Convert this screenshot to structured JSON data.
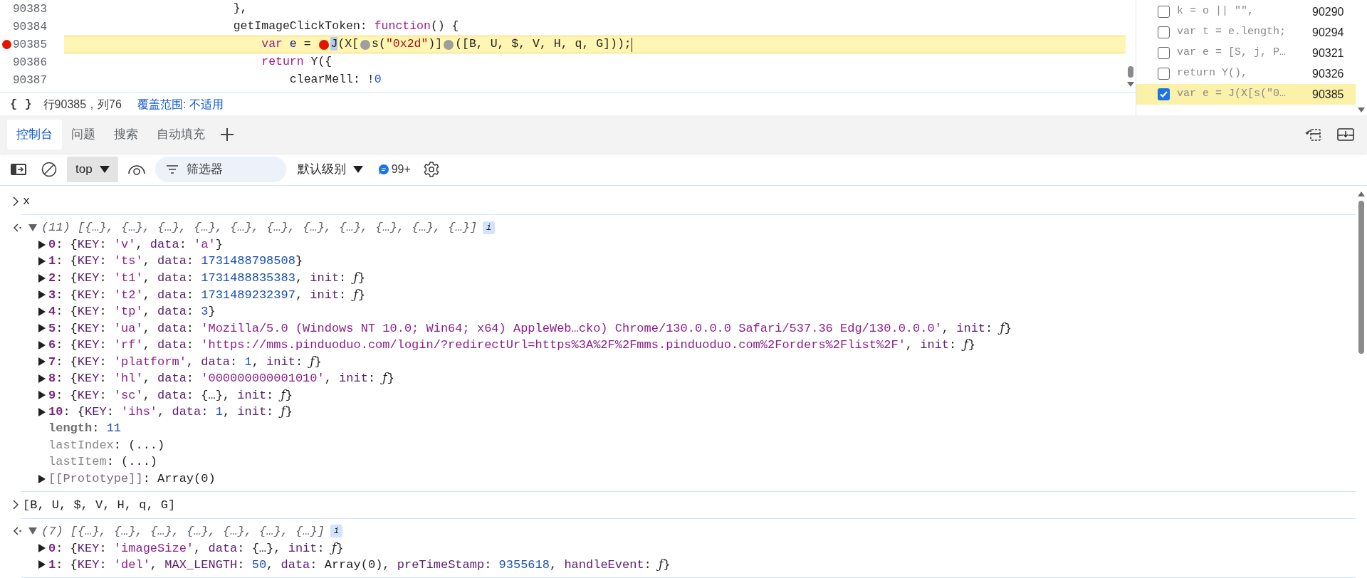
{
  "editor": {
    "lines": [
      {
        "number": "90383",
        "breakpoint": false,
        "highlighted": false,
        "cursor": false,
        "tokens": [
          {
            "kind": "plain",
            "text": "                        },"
          }
        ]
      },
      {
        "number": "90384",
        "breakpoint": false,
        "highlighted": false,
        "cursor": false,
        "tokens": [
          {
            "kind": "plain",
            "text": "                        getImageClickToken: "
          },
          {
            "kind": "keyword",
            "text": "function"
          },
          {
            "kind": "plain",
            "text": "() {"
          }
        ]
      },
      {
        "number": "90385",
        "breakpoint": true,
        "highlighted": true,
        "cursor": true,
        "tokens": [
          {
            "kind": "keyword",
            "text": "                            var"
          },
          {
            "kind": "variable",
            "text": " e"
          },
          {
            "kind": "plain",
            "text": " = "
          },
          {
            "kind": "marker",
            "active": true
          },
          {
            "kind": "selection",
            "text": "J"
          },
          {
            "kind": "plain",
            "text": "(X["
          },
          {
            "kind": "marker",
            "active": false
          },
          {
            "kind": "plain",
            "text": "s("
          },
          {
            "kind": "string",
            "text": "\"0x2d\""
          },
          {
            "kind": "plain",
            "text": ")]"
          },
          {
            "kind": "marker",
            "active": false
          },
          {
            "kind": "plain",
            "text": "([B, U, $, V, H, q, G]));"
          }
        ]
      },
      {
        "number": "90386",
        "breakpoint": false,
        "highlighted": false,
        "cursor": false,
        "tokens": [
          {
            "kind": "keyword",
            "text": "                            return"
          },
          {
            "kind": "plain",
            "text": " Y({"
          }
        ]
      },
      {
        "number": "90387",
        "breakpoint": false,
        "highlighted": false,
        "cursor": false,
        "tokens": [
          {
            "kind": "plain",
            "text": "                                clearMell: !"
          },
          {
            "kind": "number",
            "text": "0"
          }
        ]
      }
    ]
  },
  "status_bar": {
    "format_button": "{ }",
    "position": "行90385，列76",
    "coverage": "覆盖范围: 不适用"
  },
  "breakpoints": [
    {
      "code": "k = o || \"\",",
      "line": "90290",
      "checked": false,
      "current": false
    },
    {
      "code": "var t = e.length;",
      "line": "90294",
      "checked": false,
      "current": false
    },
    {
      "code": "var e = [S, j, P…",
      "line": "90321",
      "checked": false,
      "current": false
    },
    {
      "code": "return Y(),",
      "line": "90326",
      "checked": false,
      "current": false
    },
    {
      "code": "var e = J(X[s(\"0…",
      "line": "90385",
      "checked": true,
      "current": true
    }
  ],
  "drawer_tabs": [
    {
      "label": "控制台",
      "selected": true
    },
    {
      "label": "问题",
      "selected": false
    },
    {
      "label": "搜索",
      "selected": false
    },
    {
      "label": "自动填充",
      "selected": false
    }
  ],
  "toolbar": {
    "context": "top",
    "filter": {
      "placeholder": "筛选器"
    },
    "level": "默认级别",
    "messages": "99+"
  },
  "console": [
    {
      "kind": "input",
      "text": "x"
    },
    {
      "kind": "output",
      "expanded": true,
      "summary": "(11) [{…}, {…}, {…}, {…}, {…}, {…}, {…}, {…}, {…}, {…}, {…}]",
      "badge": "i",
      "rows": [
        {
          "kind": "index",
          "name": "0",
          "value": [
            {
              "kind": "punct",
              "text": ": {"
            },
            {
              "kind": "key",
              "text": "KEY"
            },
            {
              "kind": "punct",
              "text": ": "
            },
            {
              "kind": "string",
              "text": "'v'"
            },
            {
              "kind": "punct",
              "text": ", "
            },
            {
              "kind": "key",
              "text": "data"
            },
            {
              "kind": "punct",
              "text": ": "
            },
            {
              "kind": "string",
              "text": "'a'"
            },
            {
              "kind": "punct",
              "text": "}"
            }
          ]
        },
        {
          "kind": "index",
          "name": "1",
          "value": [
            {
              "kind": "punct",
              "text": ": {"
            },
            {
              "kind": "key",
              "text": "KEY"
            },
            {
              "kind": "punct",
              "text": ": "
            },
            {
              "kind": "string",
              "text": "'ts'"
            },
            {
              "kind": "punct",
              "text": ", "
            },
            {
              "kind": "key",
              "text": "data"
            },
            {
              "kind": "punct",
              "text": ": "
            },
            {
              "kind": "number",
              "text": "1731488798508"
            },
            {
              "kind": "punct",
              "text": "}"
            }
          ]
        },
        {
          "kind": "index",
          "name": "2",
          "value": [
            {
              "kind": "punct",
              "text": ": {"
            },
            {
              "kind": "key",
              "text": "KEY"
            },
            {
              "kind": "punct",
              "text": ": "
            },
            {
              "kind": "string",
              "text": "'t1'"
            },
            {
              "kind": "punct",
              "text": ", "
            },
            {
              "kind": "key",
              "text": "data"
            },
            {
              "kind": "punct",
              "text": ": "
            },
            {
              "kind": "number",
              "text": "1731488835383"
            },
            {
              "kind": "punct",
              "text": ", "
            },
            {
              "kind": "key",
              "text": "init"
            },
            {
              "kind": "punct",
              "text": ": "
            },
            {
              "kind": "func",
              "text": "ƒ"
            },
            {
              "kind": "punct",
              "text": "}"
            }
          ]
        },
        {
          "kind": "index",
          "name": "3",
          "value": [
            {
              "kind": "punct",
              "text": ": {"
            },
            {
              "kind": "key",
              "text": "KEY"
            },
            {
              "kind": "punct",
              "text": ": "
            },
            {
              "kind": "string",
              "text": "'t2'"
            },
            {
              "kind": "punct",
              "text": ", "
            },
            {
              "kind": "key",
              "text": "data"
            },
            {
              "kind": "punct",
              "text": ": "
            },
            {
              "kind": "number",
              "text": "1731489232397"
            },
            {
              "kind": "punct",
              "text": ", "
            },
            {
              "kind": "key",
              "text": "init"
            },
            {
              "kind": "punct",
              "text": ": "
            },
            {
              "kind": "func",
              "text": "ƒ"
            },
            {
              "kind": "punct",
              "text": "}"
            }
          ]
        },
        {
          "kind": "index",
          "name": "4",
          "value": [
            {
              "kind": "punct",
              "text": ": {"
            },
            {
              "kind": "key",
              "text": "KEY"
            },
            {
              "kind": "punct",
              "text": ": "
            },
            {
              "kind": "string",
              "text": "'tp'"
            },
            {
              "kind": "punct",
              "text": ", "
            },
            {
              "kind": "key",
              "text": "data"
            },
            {
              "kind": "punct",
              "text": ": "
            },
            {
              "kind": "number",
              "text": "3"
            },
            {
              "kind": "punct",
              "text": "}"
            }
          ]
        },
        {
          "kind": "index",
          "name": "5",
          "value": [
            {
              "kind": "punct",
              "text": ": {"
            },
            {
              "kind": "key",
              "text": "KEY"
            },
            {
              "kind": "punct",
              "text": ": "
            },
            {
              "kind": "string",
              "text": "'ua'"
            },
            {
              "kind": "punct",
              "text": ", "
            },
            {
              "kind": "key",
              "text": "data"
            },
            {
              "kind": "punct",
              "text": ": "
            },
            {
              "kind": "string",
              "text": "'Mozilla/5.0 (Windows NT 10.0; Win64; x64) AppleWeb…cko) Chrome/130.0.0.0 Safari/537.36 Edg/130.0.0.0'"
            },
            {
              "kind": "punct",
              "text": ", "
            },
            {
              "kind": "key",
              "text": "init"
            },
            {
              "kind": "punct",
              "text": ": "
            },
            {
              "kind": "func",
              "text": "ƒ"
            },
            {
              "kind": "punct",
              "text": "}"
            }
          ]
        },
        {
          "kind": "index",
          "name": "6",
          "value": [
            {
              "kind": "punct",
              "text": ": {"
            },
            {
              "kind": "key",
              "text": "KEY"
            },
            {
              "kind": "punct",
              "text": ": "
            },
            {
              "kind": "string",
              "text": "'rf'"
            },
            {
              "kind": "punct",
              "text": ", "
            },
            {
              "kind": "key",
              "text": "data"
            },
            {
              "kind": "punct",
              "text": ": "
            },
            {
              "kind": "string",
              "text": "'https://mms.pinduoduo.com/login/?redirectUrl=https%3A%2F%2Fmms.pinduoduo.com%2Forders%2Flist%2F'"
            },
            {
              "kind": "punct",
              "text": ", "
            },
            {
              "kind": "key",
              "text": "init"
            },
            {
              "kind": "punct",
              "text": ": "
            },
            {
              "kind": "func",
              "text": "ƒ"
            },
            {
              "kind": "punct",
              "text": "}"
            }
          ]
        },
        {
          "kind": "index",
          "name": "7",
          "value": [
            {
              "kind": "punct",
              "text": ": {"
            },
            {
              "kind": "key",
              "text": "KEY"
            },
            {
              "kind": "punct",
              "text": ": "
            },
            {
              "kind": "string",
              "text": "'platform'"
            },
            {
              "kind": "punct",
              "text": ", "
            },
            {
              "kind": "key",
              "text": "data"
            },
            {
              "kind": "punct",
              "text": ": "
            },
            {
              "kind": "number",
              "text": "1"
            },
            {
              "kind": "punct",
              "text": ", "
            },
            {
              "kind": "key",
              "text": "init"
            },
            {
              "kind": "punct",
              "text": ": "
            },
            {
              "kind": "func",
              "text": "ƒ"
            },
            {
              "kind": "punct",
              "text": "}"
            }
          ]
        },
        {
          "kind": "index",
          "name": "8",
          "value": [
            {
              "kind": "punct",
              "text": ": {"
            },
            {
              "kind": "key",
              "text": "KEY"
            },
            {
              "kind": "punct",
              "text": ": "
            },
            {
              "kind": "string",
              "text": "'hl'"
            },
            {
              "kind": "punct",
              "text": ", "
            },
            {
              "kind": "key",
              "text": "data"
            },
            {
              "kind": "punct",
              "text": ": "
            },
            {
              "kind": "string",
              "text": "'000000000001010'"
            },
            {
              "kind": "punct",
              "text": ", "
            },
            {
              "kind": "key",
              "text": "init"
            },
            {
              "kind": "punct",
              "text": ": "
            },
            {
              "kind": "func",
              "text": "ƒ"
            },
            {
              "kind": "punct",
              "text": "}"
            }
          ]
        },
        {
          "kind": "index",
          "name": "9",
          "value": [
            {
              "kind": "punct",
              "text": ": {"
            },
            {
              "kind": "key",
              "text": "KEY"
            },
            {
              "kind": "punct",
              "text": ": "
            },
            {
              "kind": "string",
              "text": "'sc'"
            },
            {
              "kind": "punct",
              "text": ", "
            },
            {
              "kind": "key",
              "text": "data"
            },
            {
              "kind": "punct",
              "text": ": {…}, "
            },
            {
              "kind": "key",
              "text": "init"
            },
            {
              "kind": "punct",
              "text": ": "
            },
            {
              "kind": "func",
              "text": "ƒ"
            },
            {
              "kind": "punct",
              "text": "}"
            }
          ]
        },
        {
          "kind": "index",
          "name": "10",
          "value": [
            {
              "kind": "punct",
              "text": ": {"
            },
            {
              "kind": "key",
              "text": "KEY"
            },
            {
              "kind": "punct",
              "text": ": "
            },
            {
              "kind": "string",
              "text": "'ihs'"
            },
            {
              "kind": "punct",
              "text": ", "
            },
            {
              "kind": "key",
              "text": "data"
            },
            {
              "kind": "punct",
              "text": ": "
            },
            {
              "kind": "number",
              "text": "1"
            },
            {
              "kind": "punct",
              "text": ", "
            },
            {
              "kind": "key",
              "text": "init"
            },
            {
              "kind": "punct",
              "text": ": "
            },
            {
              "kind": "func",
              "text": "ƒ"
            },
            {
              "kind": "punct",
              "text": "}"
            }
          ]
        },
        {
          "kind": "own",
          "name": "length",
          "value": [
            {
              "kind": "punct",
              "text": ": "
            },
            {
              "kind": "number",
              "text": "11"
            }
          ]
        },
        {
          "kind": "getter",
          "name": "lastIndex",
          "value": [
            {
              "kind": "punct",
              "text": ": (...)"
            }
          ]
        },
        {
          "kind": "getter",
          "name": "lastItem",
          "value": [
            {
              "kind": "punct",
              "text": ": (...)"
            }
          ]
        },
        {
          "kind": "internal",
          "name": "[[Prototype]]",
          "value": [
            {
              "kind": "punct",
              "text": ": Array(0)"
            }
          ]
        }
      ]
    },
    {
      "kind": "input",
      "text": "[B, U, $, V, H, q, G]"
    },
    {
      "kind": "output",
      "expanded": true,
      "summary": "(7) [{…}, {…}, {…}, {…}, {…}, {…}, {…}]",
      "badge": "i",
      "rows": [
        {
          "kind": "index",
          "name": "0",
          "value": [
            {
              "kind": "punct",
              "text": ": {"
            },
            {
              "kind": "key",
              "text": "KEY"
            },
            {
              "kind": "punct",
              "text": ": "
            },
            {
              "kind": "string",
              "text": "'imageSize'"
            },
            {
              "kind": "punct",
              "text": ", "
            },
            {
              "kind": "key",
              "text": "data"
            },
            {
              "kind": "punct",
              "text": ": {…}, "
            },
            {
              "kind": "key",
              "text": "init"
            },
            {
              "kind": "punct",
              "text": ": "
            },
            {
              "kind": "func",
              "text": "ƒ"
            },
            {
              "kind": "punct",
              "text": "}"
            }
          ]
        },
        {
          "kind": "index",
          "name": "1",
          "value": [
            {
              "kind": "punct",
              "text": ": {"
            },
            {
              "kind": "key",
              "text": "KEY"
            },
            {
              "kind": "punct",
              "text": ": "
            },
            {
              "kind": "string",
              "text": "'del'"
            },
            {
              "kind": "punct",
              "text": ", "
            },
            {
              "kind": "key",
              "text": "MAX_LENGTH"
            },
            {
              "kind": "punct",
              "text": ": "
            },
            {
              "kind": "number",
              "text": "50"
            },
            {
              "kind": "punct",
              "text": ", "
            },
            {
              "kind": "key",
              "text": "data"
            },
            {
              "kind": "punct",
              "text": ": Array(0), "
            },
            {
              "kind": "key",
              "text": "preTimeStamp"
            },
            {
              "kind": "punct",
              "text": ": "
            },
            {
              "kind": "number",
              "text": "9355618"
            },
            {
              "kind": "punct",
              "text": ", "
            },
            {
              "kind": "key",
              "text": "handleEvent"
            },
            {
              "kind": "punct",
              "text": ": "
            },
            {
              "kind": "func",
              "text": "ƒ"
            },
            {
              "kind": "punct",
              "text": "}"
            }
          ]
        }
      ]
    }
  ]
}
